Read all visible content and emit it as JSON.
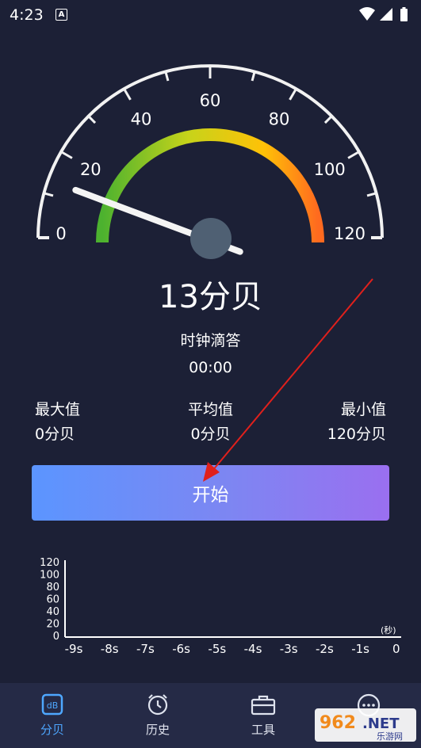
{
  "status_bar": {
    "time": "4:23",
    "notification_letter": "A"
  },
  "gauge": {
    "current_value": 13,
    "min": 0,
    "max": 120,
    "tick_labels": [
      "0",
      "20",
      "40",
      "60",
      "80",
      "100",
      "120"
    ],
    "arc_colors": [
      "#4cb22f",
      "#c7d31a",
      "#ffc107",
      "#ff6a1f"
    ]
  },
  "reading": {
    "value": "13",
    "unit": "分贝"
  },
  "mode_label": "时钟滴答",
  "timer": "00:00",
  "stats": {
    "max": {
      "label": "最大值",
      "value": "0分贝"
    },
    "avg": {
      "label": "平均值",
      "value": "0分贝"
    },
    "min": {
      "label": "最小值",
      "value": "120分贝"
    }
  },
  "start_button": "开始",
  "history_chart": {
    "y_ticks": [
      "120",
      "100",
      "80",
      "60",
      "40",
      "20",
      "0"
    ],
    "x_ticks": [
      "-9s",
      "-8s",
      "-7s",
      "-6s",
      "-5s",
      "-4s",
      "-3s",
      "-2s",
      "-1s",
      "0"
    ],
    "x_unit": "(秒)"
  },
  "nav": {
    "items": [
      {
        "label": "分贝",
        "icon": "decibel-icon",
        "active": true
      },
      {
        "label": "历史",
        "icon": "clock-history-icon",
        "active": false
      },
      {
        "label": "工具",
        "icon": "toolbox-icon",
        "active": false
      },
      {
        "label": "",
        "icon": "more-icon",
        "active": false
      }
    ]
  },
  "watermark": {
    "number": "962",
    "suffix": ".NET",
    "sub": "乐游网"
  }
}
